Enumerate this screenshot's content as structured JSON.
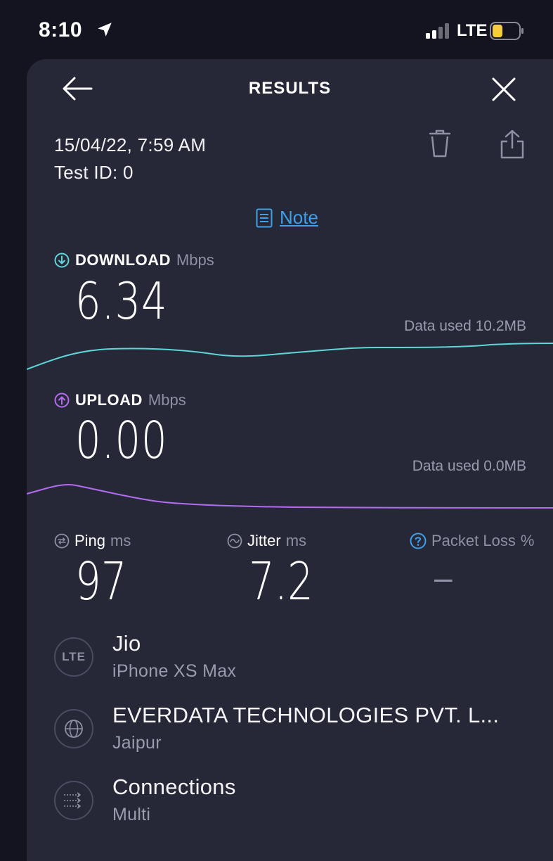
{
  "status_bar": {
    "time": "8:10",
    "network": "LTE"
  },
  "nav": {
    "title": "RESULTS"
  },
  "meta": {
    "date": "15/04/22, 7:59 AM",
    "test_id": "Test ID: 0"
  },
  "note": {
    "label": "Note"
  },
  "download": {
    "label": "DOWNLOAD",
    "unit": "Mbps",
    "value": "6.34",
    "data_used": "Data used 10.2MB",
    "color": "#5ed6d6"
  },
  "upload": {
    "label": "UPLOAD",
    "unit": "Mbps",
    "value": "0.00",
    "data_used": "Data used 0.0MB",
    "color": "#b36cf0"
  },
  "ping": {
    "label": "Ping",
    "unit": "ms",
    "value": "97"
  },
  "jitter": {
    "label": "Jitter",
    "unit": "ms",
    "value": "7.2"
  },
  "packet_loss": {
    "label": "Packet Loss",
    "unit": "%",
    "value": "–"
  },
  "info": [
    {
      "icon": "lte-icon",
      "badge": "LTE",
      "title": "Jio",
      "subtitle": "iPhone XS Max"
    },
    {
      "icon": "globe-icon",
      "title": "EVERDATA TECHNOLOGIES PVT. L...",
      "subtitle": "Jaipur"
    },
    {
      "icon": "connections-icon",
      "title": "Connections",
      "subtitle": "Multi"
    }
  ],
  "colors": {
    "accent_link": "#3f9fe8",
    "background": "#262838"
  }
}
